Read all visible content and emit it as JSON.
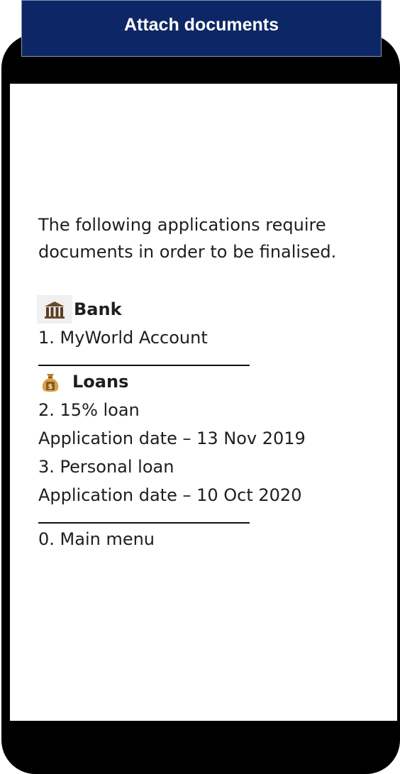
{
  "header": {
    "title": "Attach documents"
  },
  "intro": "The following applications require documents in order to be finalised.",
  "bank": {
    "icon": "bank-icon",
    "heading": "Bank",
    "items": [
      "1. MyWorld Account"
    ]
  },
  "loans": {
    "icon": "money-bag-icon",
    "heading": "Loans",
    "items": [
      "2. 15% loan",
      "Application date – 13 Nov 2019",
      "3. Personal loan",
      "Application date – 10 Oct 2020"
    ]
  },
  "footer_option": "0. Main menu",
  "colors": {
    "banner": "#0d2766",
    "phone": "#000000",
    "screen": "#ffffff",
    "text": "#1e1e1e",
    "money_bag": "#d9a24a"
  }
}
